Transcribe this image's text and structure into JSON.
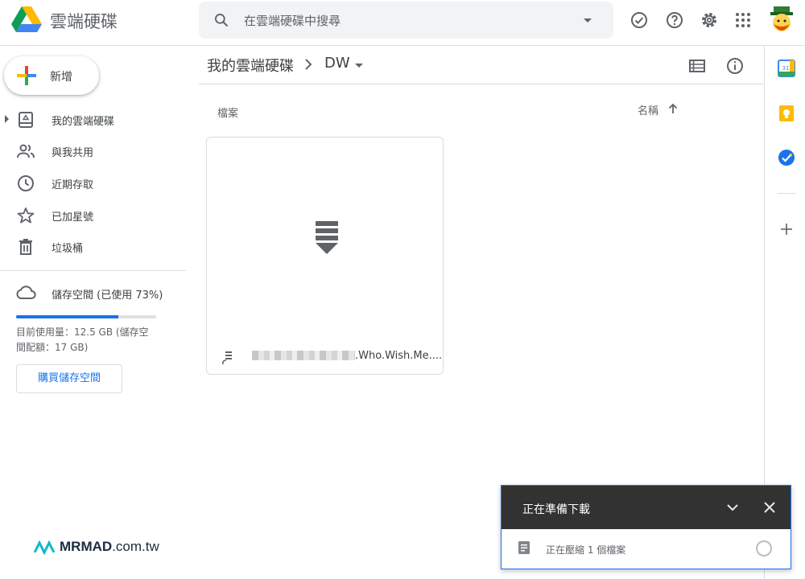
{
  "app": {
    "title": "雲端硬碟"
  },
  "search": {
    "placeholder": "在雲端硬碟中搜尋"
  },
  "sidebar": {
    "new_label": "新增",
    "items": [
      {
        "label": "我的雲端硬碟",
        "icon": "my-drive-icon"
      },
      {
        "label": "與我共用",
        "icon": "shared-icon"
      },
      {
        "label": "近期存取",
        "icon": "clock-icon"
      },
      {
        "label": "已加星號",
        "icon": "star-icon"
      },
      {
        "label": "垃圾桶",
        "icon": "trash-icon"
      }
    ],
    "storage": {
      "label": "儲存空間 (已使用 73%)",
      "used_fraction": 0.73,
      "usage_text": "目前使用量：12.5 GB (儲存空間配額：17 GB)",
      "buy_label": "購買儲存空間"
    }
  },
  "breadcrumb": {
    "root": "我的雲端硬碟",
    "current": "DW"
  },
  "files": {
    "section_label": "檔案",
    "sort_label": "名稱",
    "items": [
      {
        "name": ".Who.Wish.Me...."
      }
    ]
  },
  "toast": {
    "title": "正在準備下載",
    "status": "正在壓縮 1 個檔案"
  },
  "branding": {
    "brand": "MRMAD",
    "suffix": ".com.tw"
  },
  "colors": {
    "accent": "#1a73e8",
    "toast_header": "#323232"
  }
}
